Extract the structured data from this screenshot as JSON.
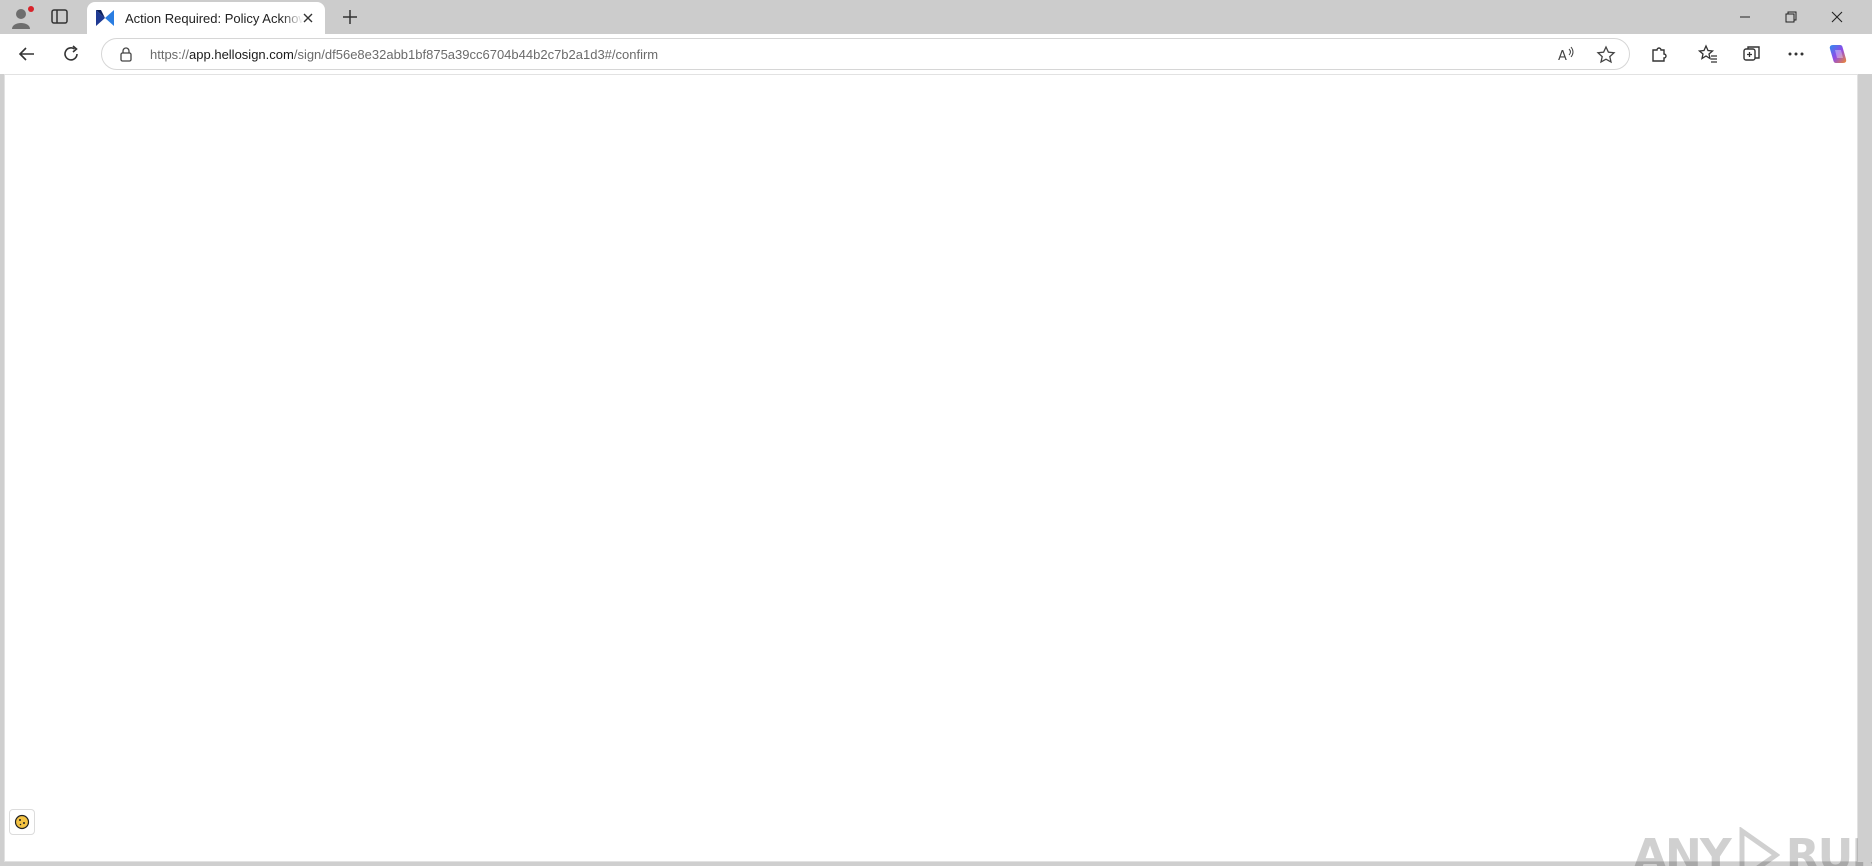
{
  "tab": {
    "title": "Action Required: Policy Acknowledgement",
    "favicon": "hellosign-logo-icon"
  },
  "address_bar": {
    "scheme": "https://",
    "host": "app.hellosign.com",
    "path": "/sign/df56e8e32abb1bf875a39cc6704b44b2c7b2a1d3#/confirm"
  },
  "watermark": {
    "left_text": "ANY",
    "right_text": "RUN"
  },
  "icons": {
    "profile": "profile-icon",
    "workspaces": "workspaces-icon",
    "new_tab": "plus-icon",
    "back": "back-arrow-icon",
    "refresh": "refresh-icon",
    "lock": "lock-icon",
    "read_aloud": "read-aloud-icon",
    "favorite": "star-icon",
    "extensions": "puzzle-icon",
    "favorites": "favorites-list-icon",
    "collections": "collections-icon",
    "menu": "more-dots-icon",
    "copilot": "copilot-icon",
    "cookie": "cookie-icon"
  },
  "colors": {
    "chrome": "#cccccc",
    "page": "#ffffff",
    "notification_dot": "#d8232a",
    "favicon_blue": "#2a5bd7"
  }
}
